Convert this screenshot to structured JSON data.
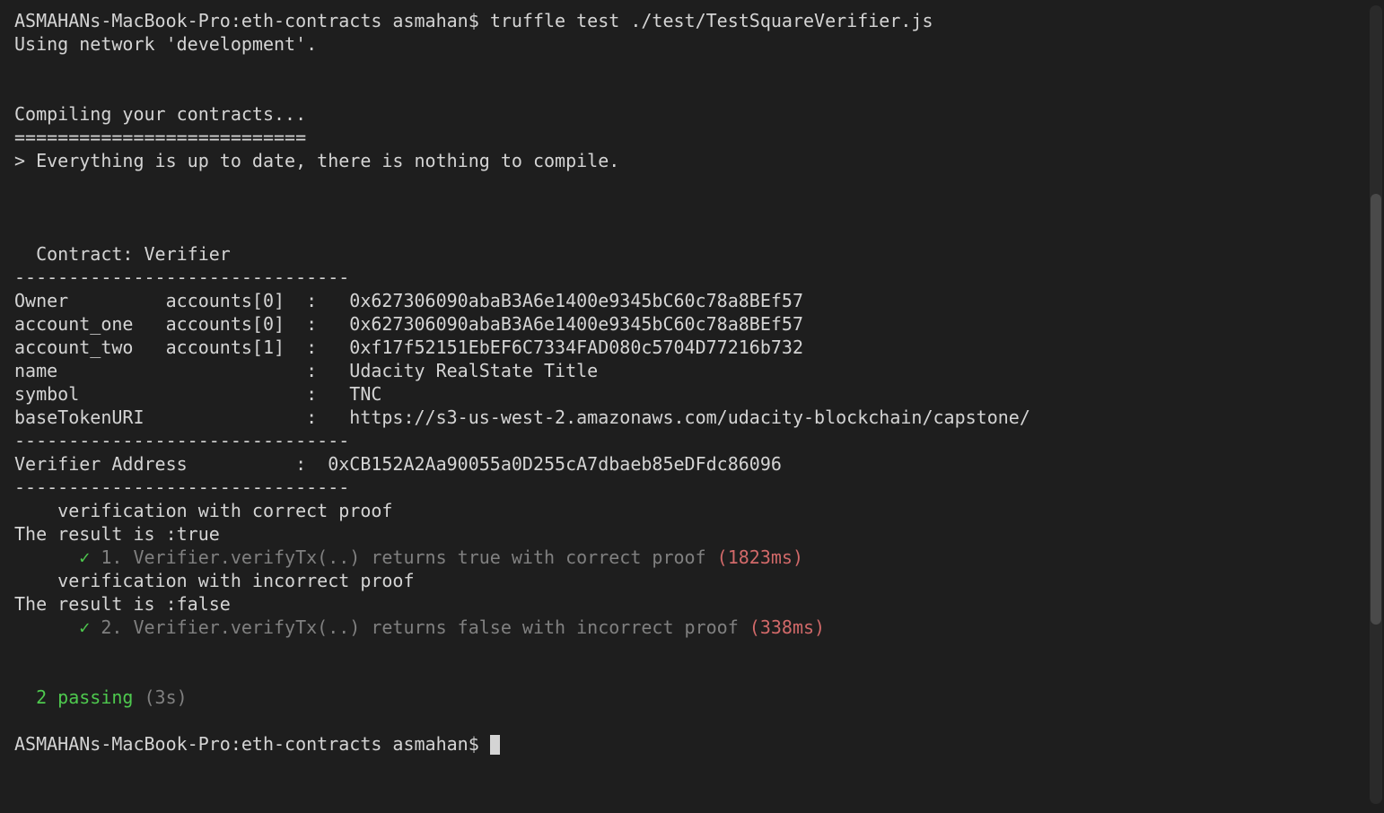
{
  "prompt1": "ASMAHANs-MacBook-Pro:eth-contracts asmahan$ ",
  "command": "truffle test ./test/TestSquareVerifier.js",
  "using_network": "Using network 'development'.",
  "compiling": "Compiling your contracts...",
  "compiling_divider": "===========================",
  "everything_up": "> Everything is up to date, there is nothing to compile.",
  "contract_header": "  Contract: Verifier",
  "dash_divider": "-------------------------------",
  "owner_line": "Owner         accounts[0]  :   0x627306090abaB3A6e1400e9345bC60c78a8BEf57",
  "account_one_line": "account_one   accounts[0]  :   0x627306090abaB3A6e1400e9345bC60c78a8BEf57",
  "account_two_line": "account_two   accounts[1]  :   0xf17f52151EbEF6C7334FAD080c5704D77216b732",
  "name_line": "name                       :   Udacity RealState Title",
  "symbol_line": "symbol                     :   TNC",
  "base_uri_line": "baseTokenURI               :   https://s3-us-west-2.amazonaws.com/udacity-blockchain/capstone/",
  "verifier_line": "Verifier Address          :  0xCB152A2Aa90055a0D255cA7dbaeb85eDFdc86096",
  "verification_correct": "    verification with correct proof",
  "result_true": "The result is :true",
  "test1_check": "      ✓ ",
  "test1_desc": "1. Verifier.verifyTx(..) returns true with correct proof ",
  "test1_time": "(1823ms)",
  "verification_incorrect": "    verification with incorrect proof",
  "result_false": "The result is :false",
  "test2_check": "      ✓ ",
  "test2_desc": "2. Verifier.verifyTx(..) returns false with incorrect proof ",
  "test2_time": "(338ms)",
  "passing_count": "  2 passing",
  "passing_time": " (3s)",
  "prompt2": "ASMAHANs-MacBook-Pro:eth-contracts asmahan$ "
}
